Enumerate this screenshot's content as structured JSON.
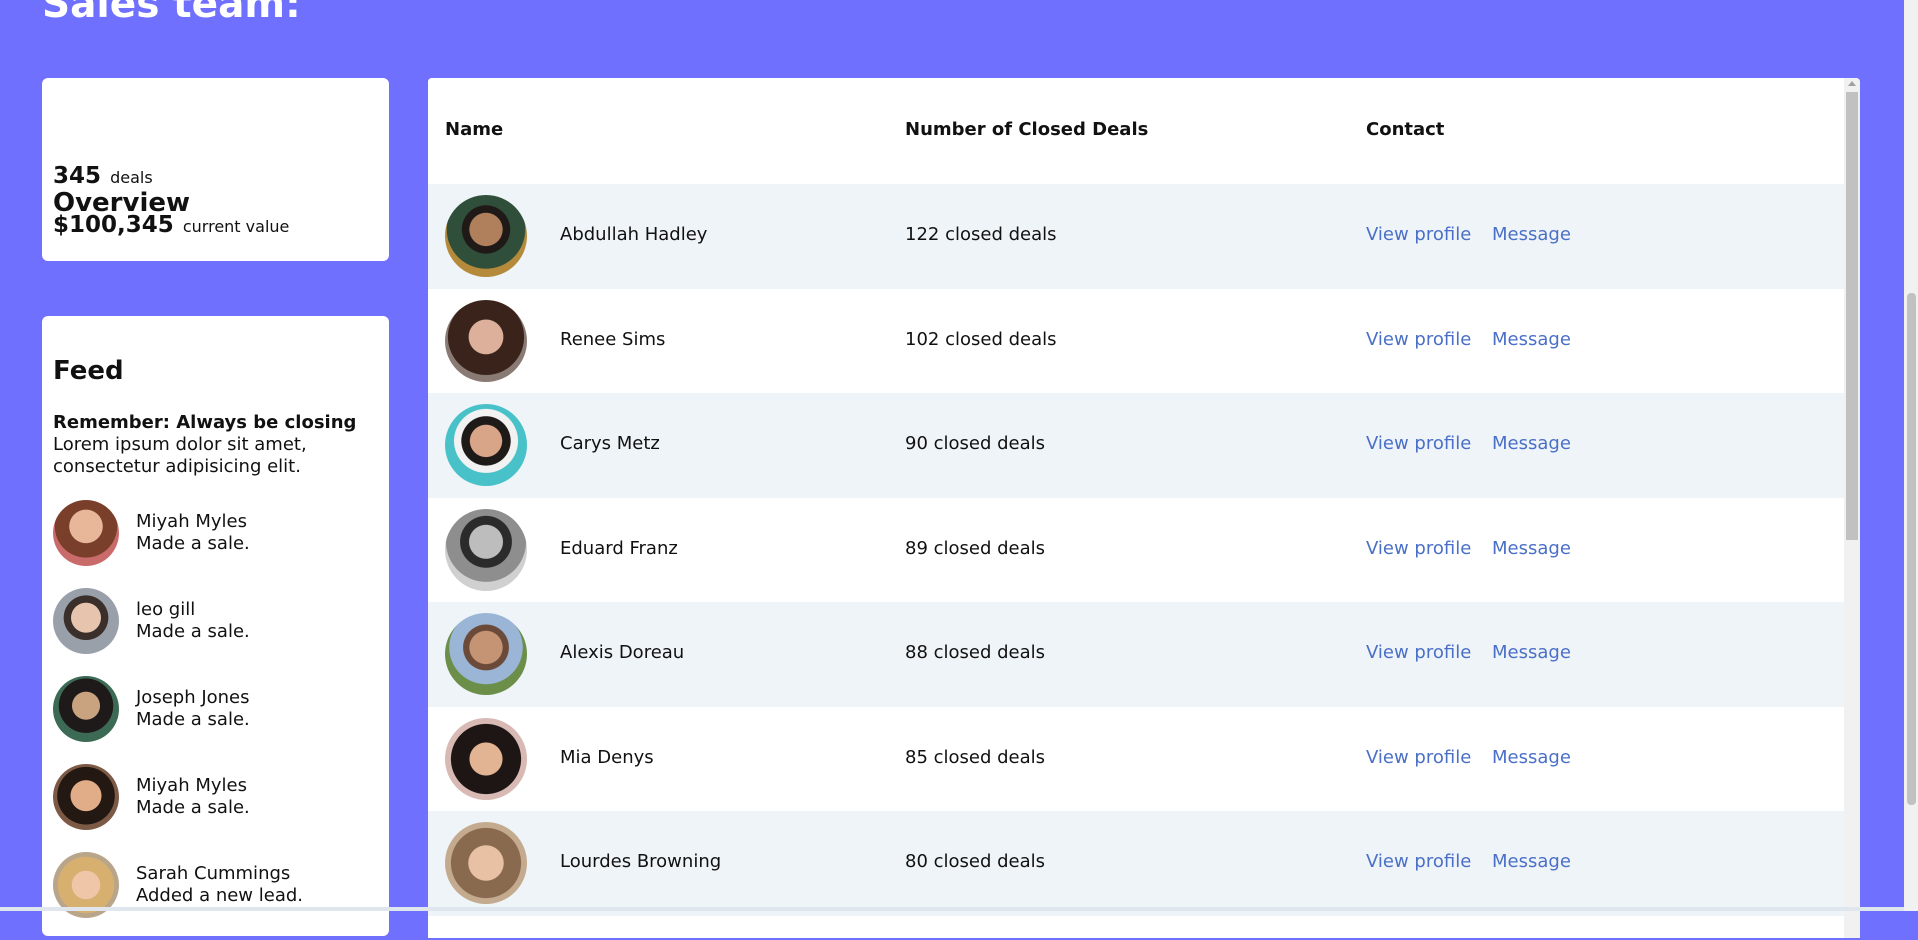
{
  "page": {
    "title": "Sales team:"
  },
  "overview": {
    "title": "Overview",
    "deals_value": "345",
    "deals_label": "deals",
    "amount_value": "$100,345",
    "amount_label": "current value"
  },
  "feed": {
    "title": "Feed",
    "note_title": "Remember: Always be closing",
    "note_text": "Lorem ipsum dolor sit amet, consectetur adipisicing elit.",
    "items": [
      {
        "name": "Miyah Myles",
        "action": "Made a sale."
      },
      {
        "name": "leo gill",
        "action": "Made a sale."
      },
      {
        "name": "Joseph Jones",
        "action": "Made a sale."
      },
      {
        "name": "Miyah Myles",
        "action": "Made a sale."
      },
      {
        "name": "Sarah Cummings",
        "action": "Added a new lead."
      }
    ]
  },
  "table": {
    "headers": {
      "name": "Name",
      "deals": "Number of Closed Deals",
      "contact": "Contact"
    },
    "rows": [
      {
        "name": "Abdullah Hadley",
        "deals": "122 closed deals",
        "profile": "View profile",
        "message": "Message"
      },
      {
        "name": "Renee Sims",
        "deals": "102 closed deals",
        "profile": "View profile",
        "message": "Message"
      },
      {
        "name": "Carys Metz",
        "deals": "90 closed deals",
        "profile": "View profile",
        "message": "Message"
      },
      {
        "name": "Eduard Franz",
        "deals": "89 closed deals",
        "profile": "View profile",
        "message": "Message"
      },
      {
        "name": "Alexis Doreau",
        "deals": "88 closed deals",
        "profile": "View profile",
        "message": "Message"
      },
      {
        "name": "Mia Denys",
        "deals": "85 closed deals",
        "profile": "View profile",
        "message": "Message"
      },
      {
        "name": "Lourdes Browning",
        "deals": "80 closed deals",
        "profile": "View profile",
        "message": "Message"
      }
    ]
  },
  "colors": {
    "background": "#7070fe",
    "link": "#4a6fc7",
    "row_alt": "#eff4f8"
  }
}
